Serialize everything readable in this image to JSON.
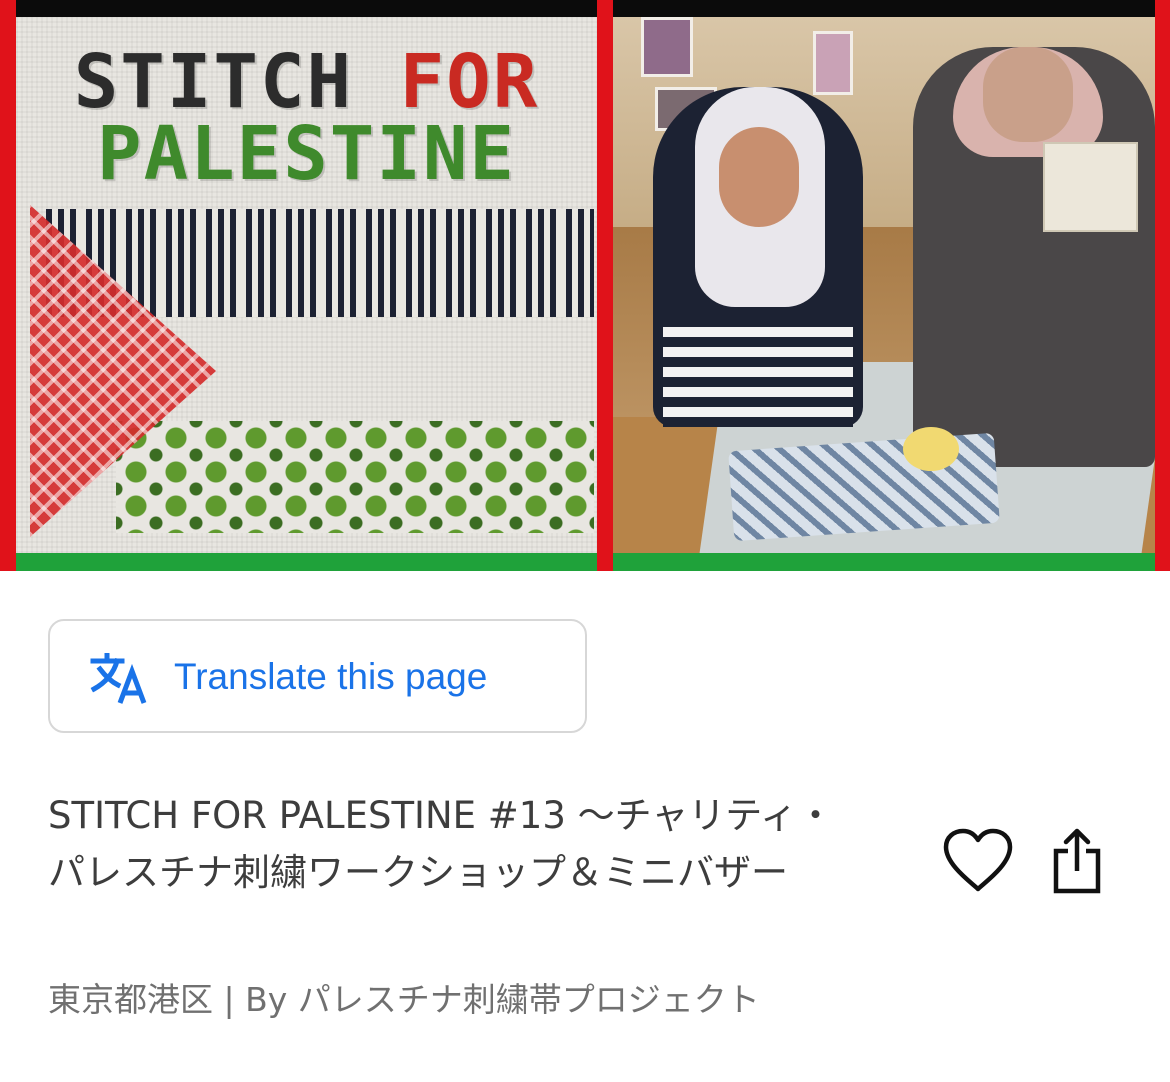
{
  "hero": {
    "banner_title_line1_word1": "STITCH",
    "banner_title_line1_word2": "FOR",
    "banner_title_line2": "PALESTINE",
    "colors": {
      "black": "#0b0b0b",
      "red": "#e0121a",
      "green": "#1fa23a"
    }
  },
  "translate": {
    "label": "Translate this page",
    "icon": "translate-icon",
    "color": "#1a73e8"
  },
  "event": {
    "title": "STITCH FOR PALESTINE #13 〜チャリティ・パレスチナ刺繍ワークショップ＆ミニバザー",
    "location": "東京都港区",
    "separator": "|",
    "organizer": "By パレスチナ刺繍帯プロジェクト"
  },
  "actions": {
    "favorite_icon": "heart-icon",
    "share_icon": "share-icon"
  }
}
